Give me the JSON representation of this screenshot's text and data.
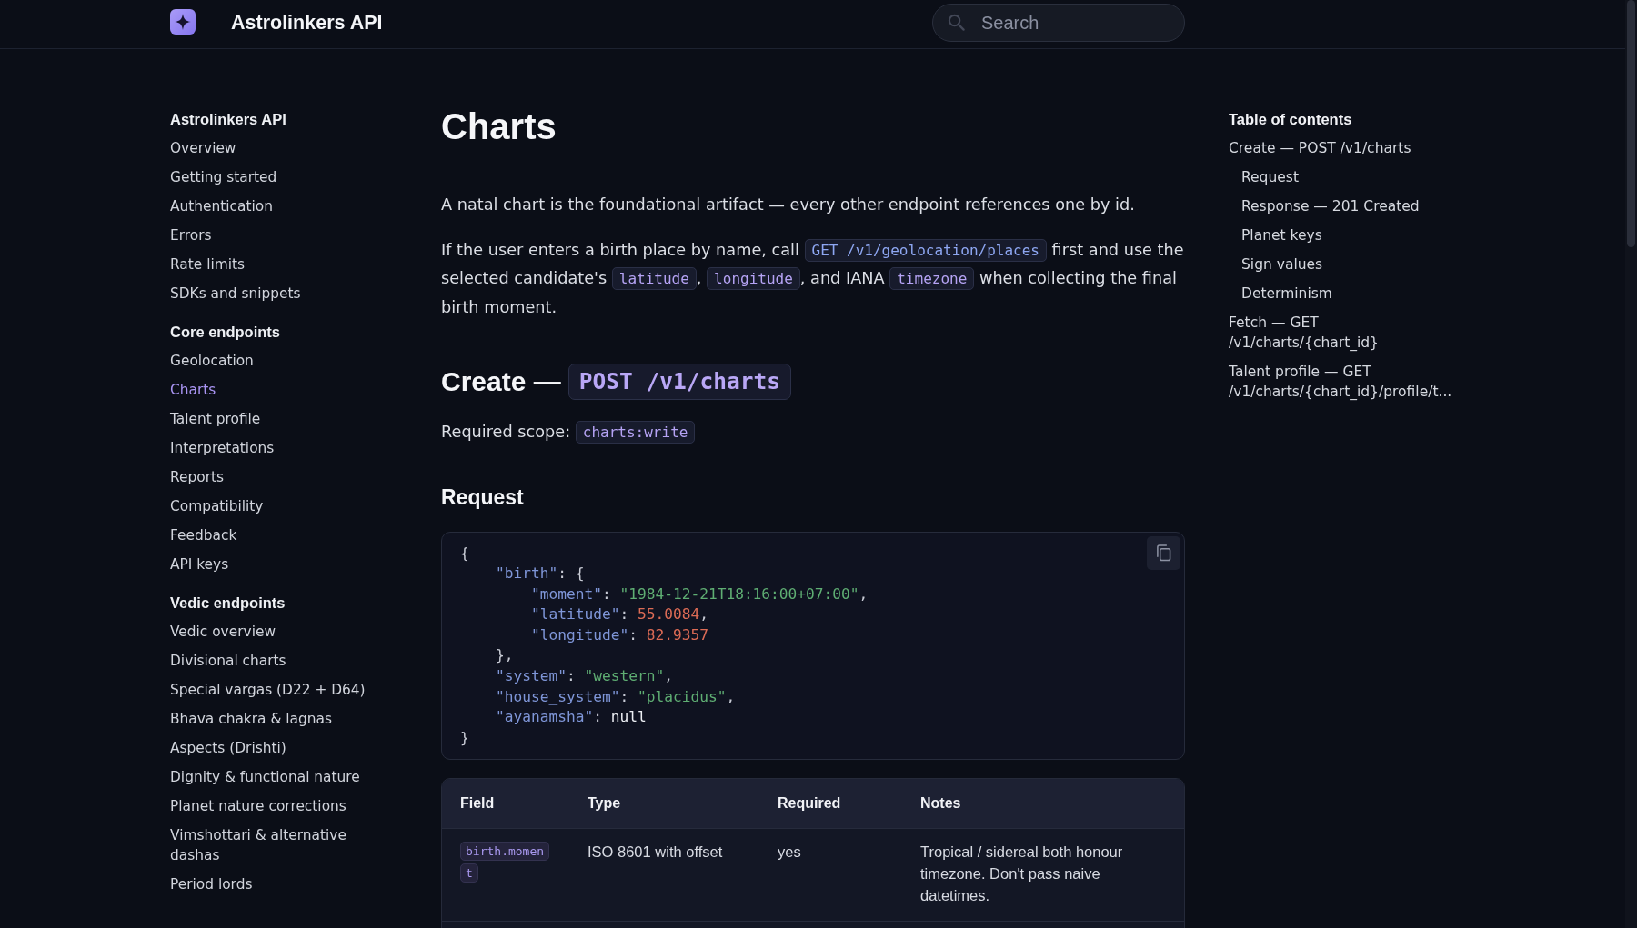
{
  "header": {
    "title": "Astrolinkers API",
    "search": {
      "placeholder": "Search"
    }
  },
  "sidebar": {
    "groups": [
      {
        "title": "Astrolinkers API",
        "items": [
          {
            "label": "Overview",
            "selected": false
          },
          {
            "label": "Getting started",
            "selected": false
          },
          {
            "label": "Authentication",
            "selected": false
          },
          {
            "label": "Errors",
            "selected": false
          },
          {
            "label": "Rate limits",
            "selected": false
          },
          {
            "label": "SDKs and snippets",
            "selected": false
          }
        ]
      },
      {
        "title": "Core endpoints",
        "items": [
          {
            "label": "Geolocation",
            "selected": false
          },
          {
            "label": "Charts",
            "selected": true
          },
          {
            "label": "Talent profile",
            "selected": false
          },
          {
            "label": "Interpretations",
            "selected": false
          },
          {
            "label": "Reports",
            "selected": false
          },
          {
            "label": "Compatibility",
            "selected": false
          },
          {
            "label": "Feedback",
            "selected": false
          },
          {
            "label": "API keys",
            "selected": false
          }
        ]
      },
      {
        "title": "Vedic endpoints",
        "items": [
          {
            "label": "Vedic overview",
            "selected": false
          },
          {
            "label": "Divisional charts",
            "selected": false
          },
          {
            "label": "Special vargas (D22 + D64)",
            "selected": false
          },
          {
            "label": "Bhava chakra & lagnas",
            "selected": false
          },
          {
            "label": "Aspects (Drishti)",
            "selected": false
          },
          {
            "label": "Dignity & functional nature",
            "selected": false
          },
          {
            "label": "Planet nature corrections",
            "selected": false
          },
          {
            "label": "Vimshottari & alternative dashas",
            "selected": false
          },
          {
            "label": "Period lords",
            "selected": false
          }
        ]
      }
    ]
  },
  "main": {
    "blocks": [
      {
        "kind": "title",
        "text": "Charts"
      },
      {
        "kind": "paragraph",
        "parts": [
          {
            "kind": "text",
            "text": "A natal chart is the foundational artifact — every other endpoint references one by id."
          }
        ]
      },
      {
        "kind": "paragraph",
        "parts": [
          {
            "kind": "text",
            "text": "If the user enters a birth place by name, call "
          },
          {
            "kind": "code_link",
            "text": "GET /v1/geolocation/places"
          },
          {
            "kind": "text",
            "text": " first and use the selected candidate's "
          },
          {
            "kind": "code",
            "text": "latitude"
          },
          {
            "kind": "text",
            "text": ", "
          },
          {
            "kind": "code",
            "text": "longitude"
          },
          {
            "kind": "text",
            "text": ", and IANA "
          },
          {
            "kind": "code",
            "text": "timezone"
          },
          {
            "kind": "text",
            "text": " when collecting the final birth moment."
          }
        ]
      },
      {
        "kind": "section",
        "text": "Create —",
        "code": "POST /v1/charts"
      },
      {
        "kind": "scope",
        "parts": [
          {
            "kind": "text",
            "text": "Required scope: "
          },
          {
            "kind": "code",
            "text": "charts:write"
          }
        ]
      },
      {
        "kind": "subsection",
        "text": "Request"
      },
      {
        "kind": "code_block",
        "lines": [
          [
            {
              "kind": "punct",
              "text": "{"
            }
          ],
          [
            {
              "kind": "key",
              "text": "    \"birth\""
            },
            {
              "kind": "punct",
              "text": ": {"
            }
          ],
          [
            {
              "kind": "key",
              "text": "        \"moment\""
            },
            {
              "kind": "punct",
              "text": ": "
            },
            {
              "kind": "string",
              "text": "\"1984-12-21T18:16:00+07:00\""
            },
            {
              "kind": "punct",
              "text": ","
            }
          ],
          [
            {
              "kind": "key",
              "text": "        \"latitude\""
            },
            {
              "kind": "punct",
              "text": ": "
            },
            {
              "kind": "number",
              "text": "55.0084"
            },
            {
              "kind": "punct",
              "text": ","
            }
          ],
          [
            {
              "kind": "key",
              "text": "        \"longitude\""
            },
            {
              "kind": "punct",
              "text": ": "
            },
            {
              "kind": "number",
              "text": "82.9357"
            }
          ],
          [
            {
              "kind": "punct",
              "text": "    },"
            }
          ],
          [
            {
              "kind": "key",
              "text": "    \"system\""
            },
            {
              "kind": "punct",
              "text": ": "
            },
            {
              "kind": "string",
              "text": "\"western\""
            },
            {
              "kind": "punct",
              "text": ","
            }
          ],
          [
            {
              "kind": "key",
              "text": "    \"house_system\""
            },
            {
              "kind": "punct",
              "text": ": "
            },
            {
              "kind": "string",
              "text": "\"placidus\""
            },
            {
              "kind": "punct",
              "text": ","
            }
          ],
          [
            {
              "kind": "key",
              "text": "    \"ayanamsha\""
            },
            {
              "kind": "punct",
              "text": ": "
            },
            {
              "kind": "literal",
              "text": "null"
            }
          ],
          [
            {
              "kind": "punct",
              "text": "}"
            }
          ]
        ]
      },
      {
        "kind": "table",
        "columns": [
          "Field",
          "Type",
          "Required",
          "Notes"
        ],
        "rows": [
          {
            "cells": [
              {
                "kind": "code",
                "text": "birth.moment"
              },
              {
                "kind": "text",
                "text": "ISO 8601 with offset"
              },
              {
                "kind": "text",
                "text": "yes"
              },
              {
                "kind": "text",
                "text": "Tropical / sidereal both honour timezone. Don't pass naive datetimes."
              }
            ]
          }
        ]
      }
    ]
  },
  "toc": {
    "title": "Table of contents",
    "items": [
      {
        "label": "Create — POST /v1/charts",
        "children": [
          {
            "label": "Request"
          },
          {
            "label": "Response — 201 Created"
          },
          {
            "label": "Planet keys"
          },
          {
            "label": "Sign values"
          },
          {
            "label": "Determinism"
          }
        ]
      },
      {
        "label": "Fetch — GET /v1/charts/{chart_id}"
      },
      {
        "label": "Talent profile — GET /v1/charts/{chart_id}/profile/t..."
      }
    ]
  }
}
